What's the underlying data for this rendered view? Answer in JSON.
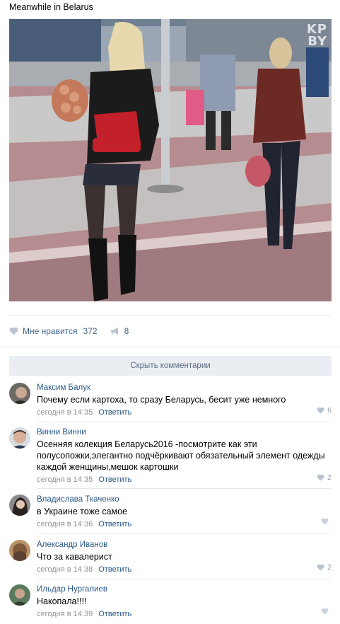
{
  "post": {
    "text": "Meanwhile in Belarus",
    "watermark_line1": "KP",
    "watermark_line2": "BY"
  },
  "actions": {
    "like_label": "Мне нравится",
    "like_count": "372",
    "share_count": "8"
  },
  "hide_comments_label": "Скрыть комментарии",
  "comments": [
    {
      "author": "Максим Балук",
      "text": "Почему если картоха, то сразу Беларусь, бесит уже немного",
      "date": "сегодня в 14:35",
      "reply": "Ответить",
      "likes": "6"
    },
    {
      "author": "Винни Винни",
      "text": "Осенняя колекция Беларусь2016 -посмотрите как эти полусопожки,элегантно подчёркивают обязательный элемент одежды каждой женщины,мешок картошки",
      "date": "сегодня в 14:35",
      "reply": "Ответить",
      "likes": "2"
    },
    {
      "author": "Владислава Ткаченко",
      "text": "в Украине тоже самое",
      "date": "сегодня в 14:36",
      "reply": "Ответить",
      "likes": ""
    },
    {
      "author": "Александр Иванов",
      "text": "Что за кавалерист",
      "date": "сегодня в 14:38",
      "reply": "Ответить",
      "likes": "2"
    },
    {
      "author": "Ильдар Нургалиев",
      "text": "Накопала!!!!",
      "date": "сегодня в 14:39",
      "reply": "Ответить",
      "likes": ""
    }
  ],
  "colors": {
    "link": "#2a5885",
    "meta": "#939393",
    "hide_bar_bg": "#eaedf2",
    "separator": "#e7e8ec"
  },
  "icons": {
    "like": "heart-icon",
    "share": "megaphone-icon"
  }
}
